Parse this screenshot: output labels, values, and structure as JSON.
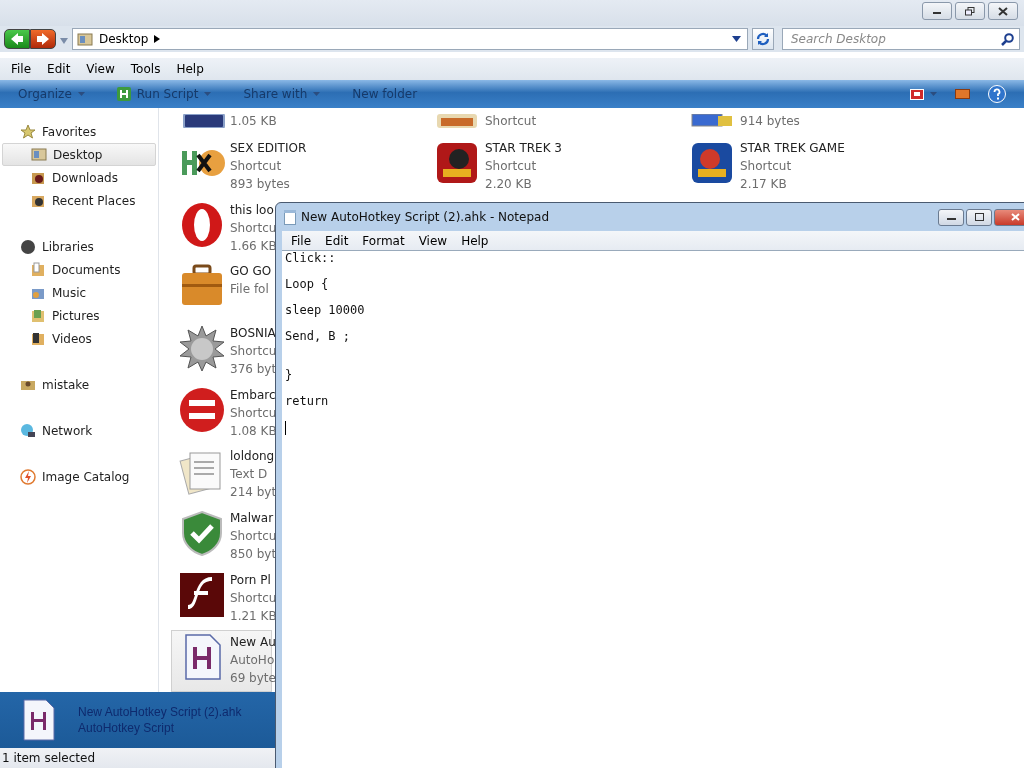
{
  "explorer": {
    "address": {
      "location": "Desktop"
    },
    "search": {
      "placeholder": "Search Desktop"
    },
    "menu": [
      "File",
      "Edit",
      "View",
      "Tools",
      "Help"
    ],
    "commands": [
      {
        "label": "Organize",
        "kind": "plain",
        "dropdown": true
      },
      {
        "label": "Run Script",
        "kind": "script",
        "dropdown": true
      },
      {
        "label": "Share with",
        "kind": "plain",
        "dropdown": true
      },
      {
        "label": "New folder",
        "kind": "plain",
        "dropdown": false
      }
    ],
    "sidebar": [
      {
        "label": "Favorites",
        "selected": false,
        "children": [
          {
            "label": "Desktop",
            "selected": true
          },
          {
            "label": "Downloads",
            "selected": false
          },
          {
            "label": "Recent Places",
            "selected": false
          }
        ]
      },
      {
        "label": "Libraries",
        "selected": false,
        "children": [
          {
            "label": "Documents",
            "selected": false
          },
          {
            "label": "Music",
            "selected": false
          },
          {
            "label": "Pictures",
            "selected": false
          },
          {
            "label": "Videos",
            "selected": false
          }
        ]
      },
      {
        "label": "mistake",
        "selected": false
      },
      {
        "label": "Network",
        "selected": false
      },
      {
        "label": "Image Catalog",
        "selected": false
      }
    ],
    "files": {
      "columns": [
        {
          "items": [
            {
              "size": "1.05 KB",
              "selected": false
            },
            {
              "name": "SEX EDITIOR",
              "type": "Shortcut",
              "size": "893 bytes",
              "selected": false
            },
            {
              "name": "this loo",
              "type": "Shortcu",
              "size": "1.66 KB",
              "selected": false
            },
            {
              "name": "GO GO",
              "type": "File fol",
              "selected": false
            },
            {
              "name": "BOSNIA",
              "type": "Shortcu",
              "size": "376 byt",
              "selected": false
            },
            {
              "name": "Embarc",
              "type": "Shortcu",
              "size": "1.08 KB",
              "selected": false
            },
            {
              "name": "loldong",
              "type": "Text D",
              "size": "214 byt",
              "selected": false
            },
            {
              "name": "Malwar",
              "type": "Shortcu",
              "size": "850 byt",
              "selected": false
            },
            {
              "name": "Porn Pl",
              "type": "Shortcu",
              "size": "1.21 KB",
              "selected": false
            },
            {
              "name": "New Au",
              "type": "AutoHo",
              "size": "69 byte",
              "selected": true
            }
          ]
        },
        {
          "items": [
            {
              "type": "Shortcut",
              "selected": false
            },
            {
              "name": "STAR TREK 3",
              "type": "Shortcut",
              "size": "2.20 KB",
              "selected": false
            }
          ]
        },
        {
          "items": [
            {
              "size": "914 bytes",
              "selected": false
            },
            {
              "name": "STAR TREK GAME",
              "type": "Shortcut",
              "size": "2.17 KB",
              "selected": false
            }
          ]
        }
      ]
    },
    "details": {
      "name": "New AutoHotkey Script (2).ahk",
      "type": "AutoHotkey Script"
    },
    "status_bar": "1 item selected"
  },
  "notepad": {
    "title": "New AutoHotkey Script (2).ahk - Notepad",
    "menu": [
      "File",
      "Edit",
      "Format",
      "View",
      "Help"
    ],
    "text": "Click::\n\nLoop {\n\nsleep 10000\n\nSend, B ;\n\n\n}\n\nreturn"
  }
}
